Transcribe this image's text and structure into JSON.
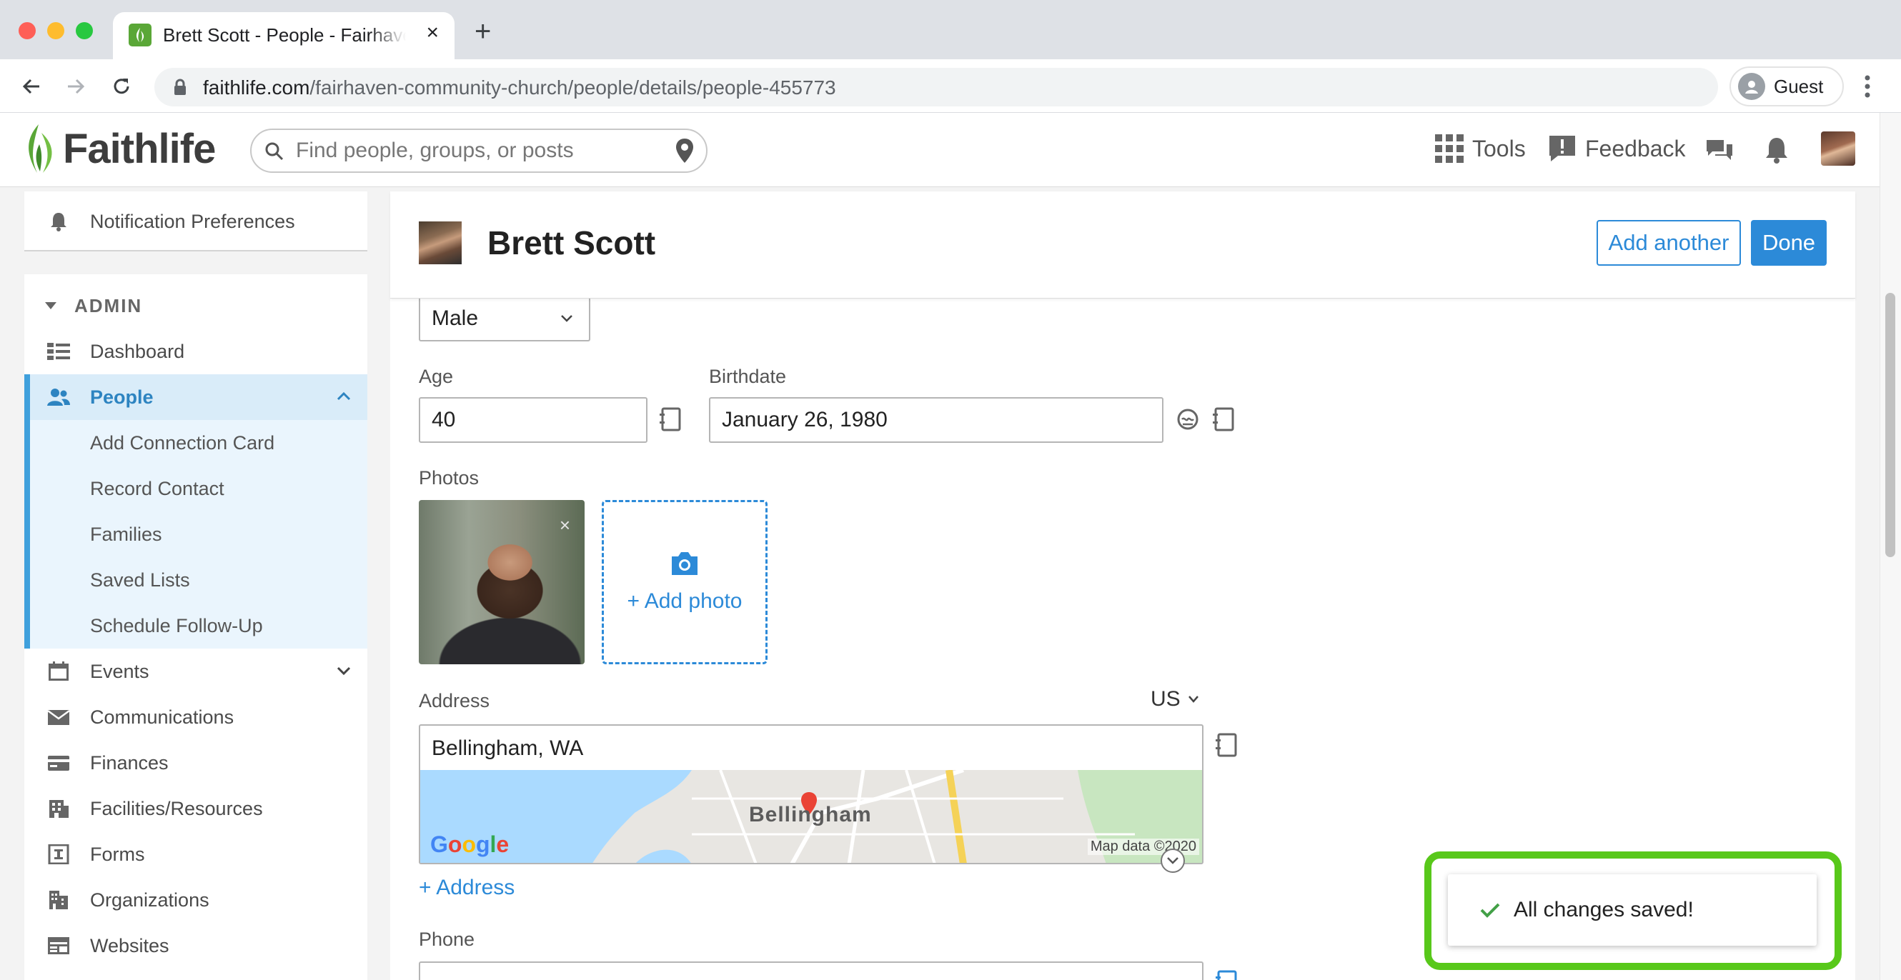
{
  "browser": {
    "tab_title": "Brett Scott - People - Fairhaven Community Church",
    "url_domain": "faithlife.com",
    "url_path": "/fairhaven-community-church/people/details/people-455773",
    "profile_label": "Guest"
  },
  "header": {
    "logo_text": "Faithlife",
    "search_placeholder": "Find people, groups, or posts",
    "tools_label": "Tools",
    "feedback_label": "Feedback"
  },
  "sidebar": {
    "notification_label": "Notification Preferences",
    "admin_label": "ADMIN",
    "items": [
      {
        "label": "Dashboard",
        "icon": "dashboard-icon"
      },
      {
        "label": "People",
        "icon": "people-icon"
      },
      {
        "label": "Add Connection Card"
      },
      {
        "label": "Record Contact"
      },
      {
        "label": "Families"
      },
      {
        "label": "Saved Lists"
      },
      {
        "label": "Schedule Follow-Up"
      },
      {
        "label": "Events",
        "icon": "calendar-icon"
      },
      {
        "label": "Communications",
        "icon": "envelope-icon"
      },
      {
        "label": "Finances",
        "icon": "credit-card-icon"
      },
      {
        "label": "Facilities/Resources",
        "icon": "building-icon"
      },
      {
        "label": "Forms",
        "icon": "form-icon"
      },
      {
        "label": "Organizations",
        "icon": "organization-icon"
      },
      {
        "label": "Websites",
        "icon": "website-icon"
      }
    ]
  },
  "person": {
    "name": "Brett Scott",
    "add_another_label": "Add another",
    "done_label": "Done"
  },
  "form": {
    "gender_value": "Male",
    "age_label": "Age",
    "age_value": "40",
    "birthdate_label": "Birthdate",
    "birthdate_value": "January 26, 1980",
    "photos_label": "Photos",
    "add_photo_label": "+ Add photo",
    "address_label": "Address",
    "country_value": "US",
    "address_value": "Bellingham, WA",
    "map_city_label": "Bellingham",
    "map_google_label": "Google",
    "map_data_label": "Map data ©2020",
    "add_address_label": "+ Address",
    "phone_label": "Phone"
  },
  "toast": {
    "message": "All changes saved!",
    "highlight_color": "#58c81a"
  },
  "colors": {
    "accent": "#2c8ad8",
    "active_bg": "#d9ecf9",
    "brand_green": "#5aa737"
  }
}
